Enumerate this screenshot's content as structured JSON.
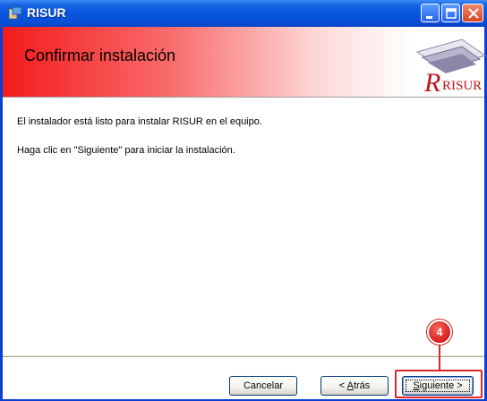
{
  "window": {
    "title": "RISUR"
  },
  "banner": {
    "title": "Confirmar instalación",
    "logo_text": "RISUR"
  },
  "content": {
    "line1": "El instalador está listo para instalar RISUR en el equipo.",
    "line2": "Haga clic en \"Siguiente\" para iniciar la instalación."
  },
  "buttons": {
    "cancel": "Cancelar",
    "back_arrow": "< ",
    "back_mnemonic": "A",
    "back_rest": "trás",
    "next_mnemonic": "S",
    "next_rest": "iguiente >"
  },
  "annotation": {
    "step": "4",
    "color": "#e0262a"
  },
  "icons": [
    "installer-app-icon",
    "minimize-icon",
    "maximize-icon",
    "close-icon",
    "risur-logo-icon"
  ]
}
